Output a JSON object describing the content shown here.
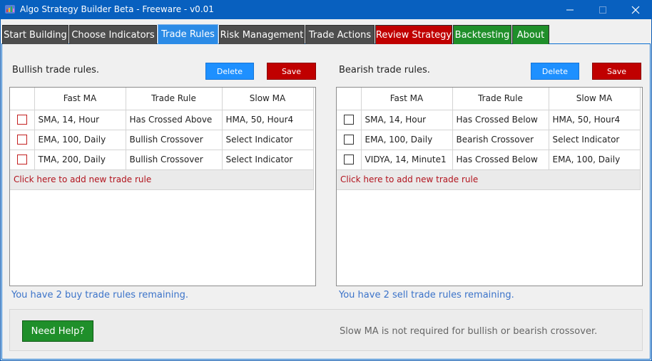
{
  "window": {
    "title": "Algo Strategy Builder Beta - Freeware - v0.01",
    "controls": [
      "minimize-icon",
      "maximize-icon",
      "close-icon"
    ]
  },
  "tabs": [
    {
      "label": "Start Building",
      "color": "#4d4d4d"
    },
    {
      "label": "Choose Indicators",
      "color": "#4d4d4d"
    },
    {
      "label": "Trade Rules",
      "color": "#2b8be6",
      "active": true
    },
    {
      "label": "Risk Management",
      "color": "#4d4d4d"
    },
    {
      "label": "Trade Actions",
      "color": "#4d4d4d"
    },
    {
      "label": "Review Strategy",
      "color": "#c00000"
    },
    {
      "label": "Backtesting",
      "color": "#1f8f2a"
    },
    {
      "label": "About",
      "color": "#1f8f2a"
    }
  ],
  "bullish": {
    "title": "Bullish trade rules.",
    "delete_label": "Delete",
    "save_label": "Save",
    "columns": [
      "Fast MA",
      "Trade Rule",
      "Slow MA"
    ],
    "rows": [
      {
        "fast": "SMA, 14, Hour",
        "rule": "Has Crossed Above",
        "slow": "HMA, 50, Hour4"
      },
      {
        "fast": "EMA, 100, Daily",
        "rule": "Bullish Crossover",
        "slow": "Select Indicator"
      },
      {
        "fast": "TMA, 200, Daily",
        "rule": "Bullish Crossover",
        "slow": "Select Indicator"
      }
    ],
    "add_rule_text": "Click here to add new trade rule",
    "remaining": "You have 2 buy trade rules remaining."
  },
  "bearish": {
    "title": "Bearish trade rules.",
    "delete_label": "Delete",
    "save_label": "Save",
    "columns": [
      "Fast MA",
      "Trade Rule",
      "Slow MA"
    ],
    "rows": [
      {
        "fast": "SMA, 14, Hour",
        "rule": "Has Crossed Below",
        "slow": "HMA, 50, Hour4"
      },
      {
        "fast": "EMA, 100, Daily",
        "rule": "Bearish Crossover",
        "slow": "Select Indicator"
      },
      {
        "fast": "VIDYA, 14, Minute1",
        "rule": "Has Crossed Below",
        "slow": "EMA, 100, Daily"
      }
    ],
    "add_rule_text": "Click here to add new trade rule",
    "remaining": "You have 2 sell trade rules remaining."
  },
  "footer": {
    "help_label": "Need Help?",
    "note": "Slow MA is not required for bullish or bearish crossover."
  }
}
